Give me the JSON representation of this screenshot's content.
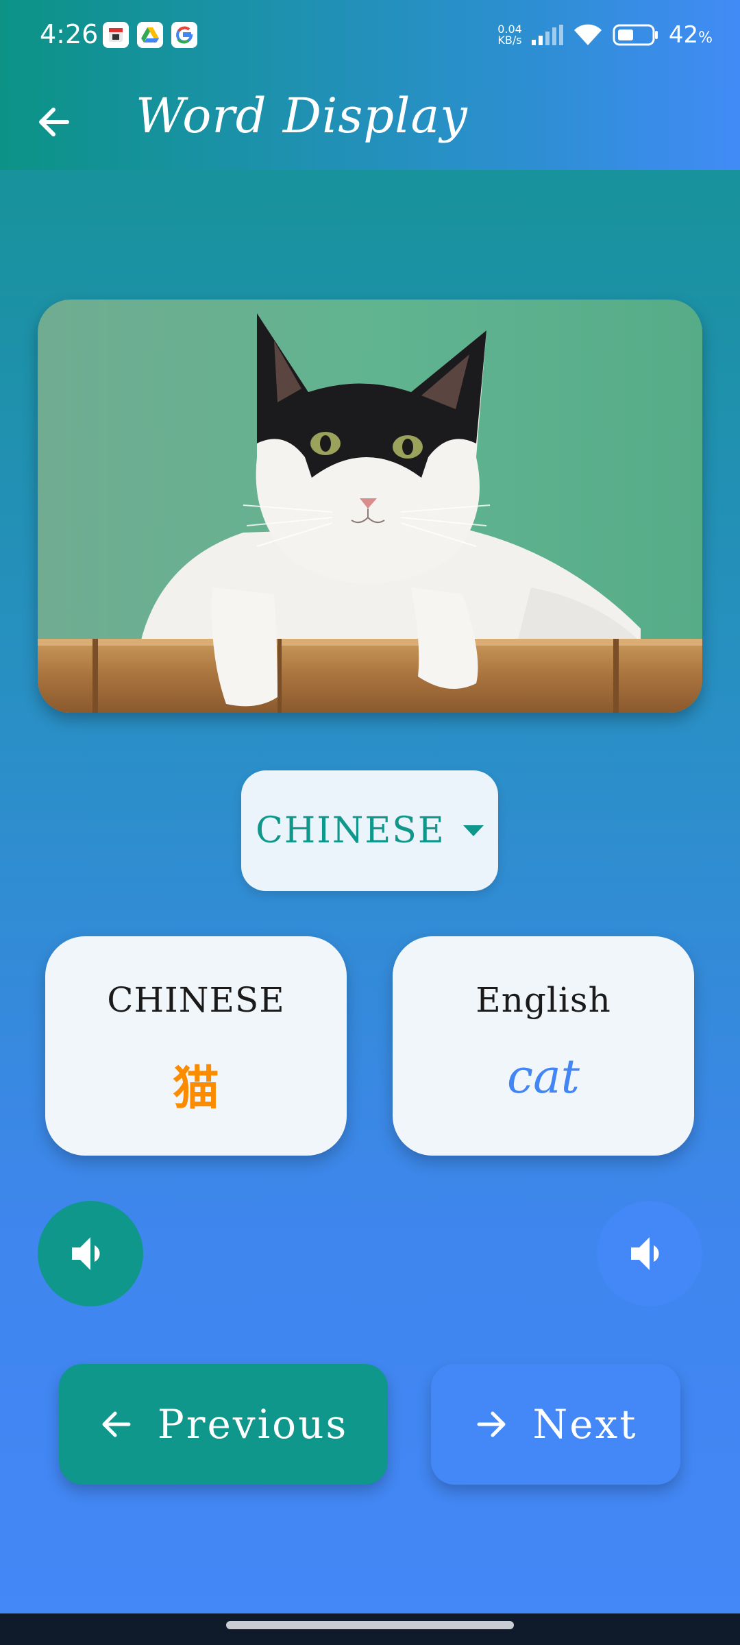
{
  "status_bar": {
    "time": "4:26",
    "net_speed_value": "0.04",
    "net_speed_unit": "KB/s",
    "battery_percent": "42",
    "battery_unit": "%"
  },
  "app_bar": {
    "title": "Word Display"
  },
  "language_selector": {
    "selected": "CHINESE"
  },
  "cards": {
    "source": {
      "language": "CHINESE",
      "word": "猫",
      "word_color": "#fb8c00"
    },
    "target": {
      "language": "English",
      "word": "cat",
      "word_color": "#4285f4"
    }
  },
  "buttons": {
    "previous_label": "Previous",
    "next_label": "Next"
  },
  "colors": {
    "teal": "#0f978c",
    "blue": "#4487f7"
  }
}
